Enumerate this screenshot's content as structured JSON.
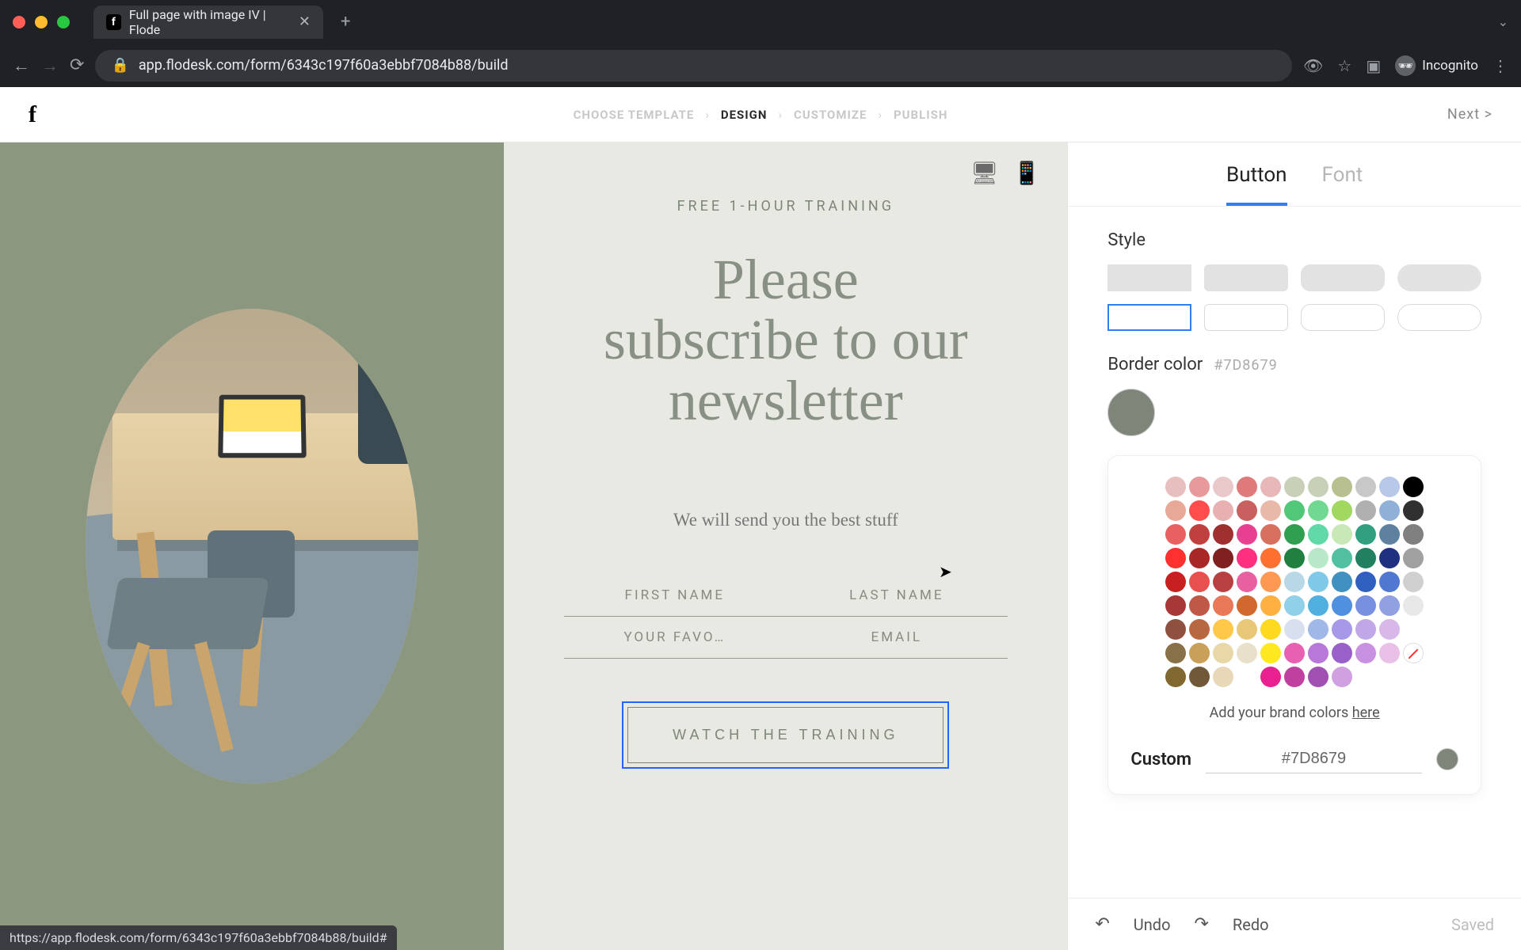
{
  "browser": {
    "tab_title": "Full page with image IV | Flode",
    "url_display": "app.flodesk.com/form/6343c197f60a3ebbf7084b88/build",
    "incognito_label": "Incognito",
    "status_url": "https://app.flodesk.com/form/6343c197f60a3ebbf7084b88/build#"
  },
  "header": {
    "steps": {
      "choose": "CHOOSE TEMPLATE",
      "design": "DESIGN",
      "customize": "CUSTOMIZE",
      "publish": "PUBLISH"
    },
    "next": "Next  >"
  },
  "preview": {
    "eyebrow": "FREE 1-HOUR TRAINING",
    "headline_l1": "Please",
    "headline_l2": "subscribe to our",
    "headline_l3": "newsletter",
    "subtext": "We will send you the best stuff",
    "fields": {
      "first_name": "FIRST NAME",
      "last_name": "LAST NAME",
      "favo": "YOUR FAVO…",
      "email": "EMAIL"
    },
    "cta": "WATCH THE TRAINING"
  },
  "sidebar": {
    "tabs": {
      "button": "Button",
      "font": "Font"
    },
    "style_label": "Style",
    "border_label": "Border color",
    "border_hex": "#7D8679",
    "palette_note_pre": "Add your brand colors ",
    "palette_note_link": "here",
    "custom_label": "Custom",
    "custom_value": "#7D8679",
    "palette": [
      [
        "#E8BFBF",
        "#E89A9A",
        "#E8C8C8",
        "#E07A7A",
        "#E8B8B8",
        "#C8D0B8",
        "#C8D0B8",
        "#B8C090",
        "#C8C8C8",
        "#B8C8E8",
        "#000000"
      ],
      [
        "#E8A898",
        "#FF4D4D",
        "#E8B0B0",
        "#C86060",
        "#E8B8A8",
        "#50C878",
        "#70D890",
        "#A0D860",
        "#B0B0B0",
        "#90B0D8",
        "#303030"
      ],
      [
        "#E86060",
        "#C04040",
        "#A03030",
        "#E84090",
        "#D87060",
        "#30A050",
        "#60D8A8",
        "#C8E8B8",
        "#30A080",
        "#6080A0",
        "#808080"
      ],
      [
        "#FF3030",
        "#A82828",
        "#802020",
        "#FF3080",
        "#FF7030",
        "#208040",
        "#B8E8C8",
        "#50C0A0",
        "#208060",
        "#203080",
        "#A0A0A0"
      ],
      [
        "#C82020",
        "#E85050",
        "#B84040",
        "#E860A0",
        "#FF9850",
        "#B8D8E8",
        "#80C8E8",
        "#4090C0",
        "#3060C0",
        "#5078D0",
        "#D0D0D0"
      ],
      [
        "#A83838",
        "#C05848",
        "#E87858",
        "#D06830",
        "#FFB040",
        "#90D0E8",
        "#50B0E0",
        "#5090E0",
        "#7890E0",
        "#90A0E0",
        "#E8E8E8"
      ],
      [
        "#905040",
        "#B86840",
        "#FFC848",
        "#E8C878",
        "#FFD820",
        "#D8E0F0",
        "#A0B8E8",
        "#A898E8",
        "#C0A8E8",
        "#D8B8E8",
        "#FFFFFF"
      ],
      [
        "#887048",
        "#C8A058",
        "#E8D8A8",
        "#E8E0C8",
        "#FFE820",
        "#E860B0",
        "#B878D8",
        "#9860C8",
        "#C890E0",
        "#E8C0E8",
        "none"
      ],
      [
        "#806830",
        "#705838",
        "#E8D8B8",
        "#FFFFFF",
        "#E82090",
        "#C040A0",
        "#A050B0",
        "#D0A0E0",
        "#",
        "#",
        "#"
      ]
    ]
  },
  "footer": {
    "undo": "Undo",
    "redo": "Redo",
    "saved": "Saved"
  }
}
